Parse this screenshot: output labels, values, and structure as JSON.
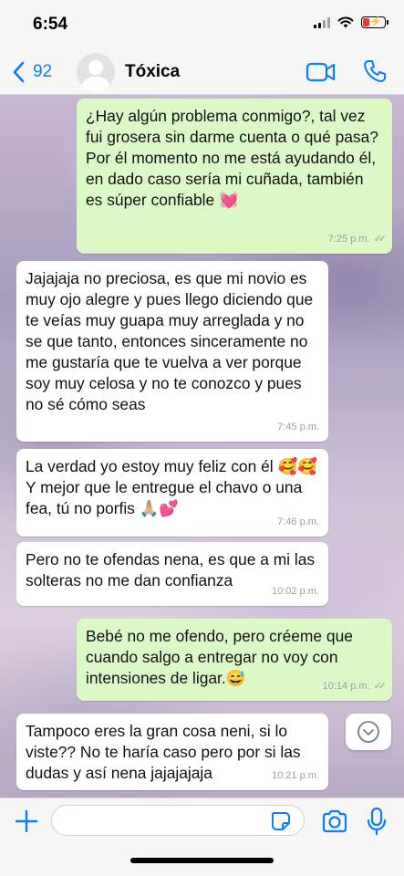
{
  "status_bar": {
    "time": "6:54"
  },
  "header": {
    "back_count": "92",
    "contact_name": "Tóxica"
  },
  "messages": [
    {
      "direction": "out",
      "text": "¿Hay algún problema conmigo?, tal vez fui grosera sin darme cuenta o qué pasa?\nPor él momento no me está ayudando él, en dado caso sería mi cuñada, también es súper confiable 💓",
      "time": "7:25 p.m."
    },
    {
      "direction": "in",
      "text": "Jajajaja no preciosa, es que mi novio es muy ojo alegre y pues llego diciendo que te veías muy guapa muy arreglada y no se que tanto, entonces sinceramente no me gustaría que te vuelva a ver porque soy muy celosa y no te conozco y pues no sé cómo seas",
      "time": "7:45 p.m."
    },
    {
      "direction": "in",
      "text": "La verdad yo estoy muy feliz con él 🥰🥰\nY mejor que le entregue el chavo o una fea, tú no porfis 🙏🏼💕",
      "time": "7:46 p.m."
    },
    {
      "direction": "in",
      "text": "Pero no te ofendas nena, es que a mi las solteras no me dan confianza",
      "time": "10:02 p.m."
    },
    {
      "direction": "out",
      "text": "Bebé no me ofendo, pero créeme que cuando salgo a entregar no voy con intensiones de ligar.😅",
      "time": "10:14 p.m."
    },
    {
      "direction": "in",
      "text": "Tampoco eres la gran cosa neni, si lo viste?? No te haría caso pero por si las dudas y así nena jajajajaja",
      "time": "10:21 p.m."
    }
  ],
  "input": {
    "value": "",
    "placeholder": ""
  },
  "colors": {
    "accent": "#0a7cff",
    "outgoing_bubble": "#dcf8c6",
    "incoming_bubble": "#ffffff"
  },
  "icons": {
    "back": "chevron-left-icon",
    "video": "video-camera-icon",
    "call": "phone-icon",
    "plus": "plus-icon",
    "sticker": "sticker-icon",
    "camera": "camera-icon",
    "mic": "microphone-icon",
    "scroll_down": "chevron-down-icon"
  }
}
